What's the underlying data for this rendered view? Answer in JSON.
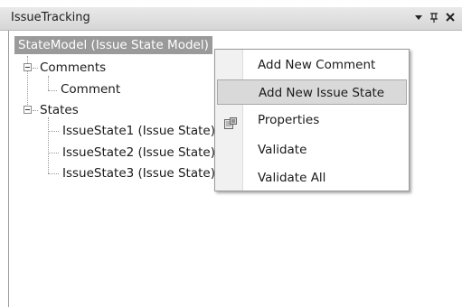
{
  "window": {
    "title": "IssueTracking",
    "buttons": {
      "dropdown": "▾",
      "pin": "ꟷ",
      "close": "✕"
    }
  },
  "tree": {
    "root": "StateModel (Issue State Model)",
    "groups": [
      {
        "label": "Comments",
        "children": [
          "Comment"
        ]
      },
      {
        "label": "States",
        "children": [
          "IssueState1 (Issue State)",
          "IssueState2 (Issue State)",
          "IssueState3 (Issue State)"
        ]
      }
    ]
  },
  "context_menu": {
    "items": [
      {
        "label": "Add New Comment",
        "icon": "",
        "highlighted": false
      },
      {
        "label": "Add New Issue State",
        "icon": "",
        "highlighted": true
      },
      {
        "label": "Properties",
        "icon": "properties-icon",
        "highlighted": false
      },
      {
        "label": "Validate",
        "icon": "",
        "highlighted": false
      },
      {
        "label": "Validate All",
        "icon": "",
        "highlighted": false
      }
    ]
  }
}
